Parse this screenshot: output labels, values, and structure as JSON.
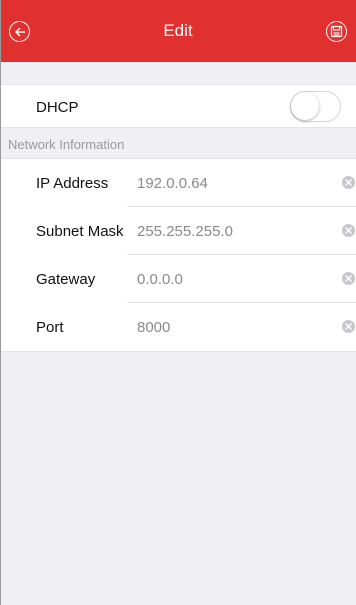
{
  "header": {
    "title": "Edit",
    "back_icon": "arrow-left-circle-icon",
    "save_icon": "save-disk-icon",
    "bar_color": "#e0302f"
  },
  "dhcp": {
    "label": "DHCP",
    "enabled": false
  },
  "section": {
    "title": "Network Information"
  },
  "fields": [
    {
      "label": "IP Address",
      "value": "192.0.0.64"
    },
    {
      "label": "Subnet Mask",
      "value": "255.255.255.0"
    },
    {
      "label": "Gateway",
      "value": "0.0.0.0"
    },
    {
      "label": "Port",
      "value": "8000"
    }
  ]
}
